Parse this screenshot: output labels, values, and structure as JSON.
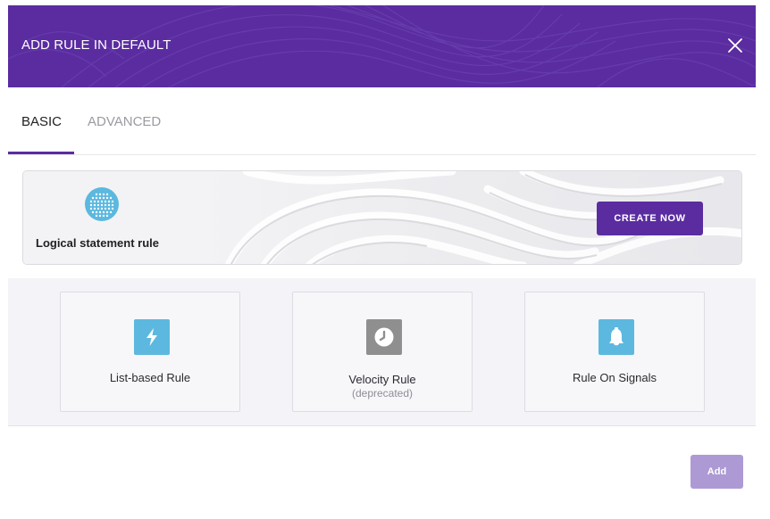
{
  "header": {
    "title": "ADD RULE IN DEFAULT",
    "close_icon": "close-icon",
    "accent_color": "#5a2ca0"
  },
  "tabs": [
    {
      "label": "BASIC",
      "active": true
    },
    {
      "label": "ADVANCED",
      "active": false
    }
  ],
  "banner": {
    "icon": "dotted-sphere-icon",
    "title": "Logical statement rule",
    "button_label": "CREATE NOW"
  },
  "rule_types": [
    {
      "label": "List-based Rule",
      "sublabel": "",
      "icon": "lightning-icon",
      "color": "#5cb8de"
    },
    {
      "label": "Velocity Rule",
      "sublabel": "(deprecated)",
      "icon": "clock-icon",
      "color": "#8f8f8f"
    },
    {
      "label": "Rule On Signals",
      "sublabel": "",
      "icon": "bell-icon",
      "color": "#5cb8de"
    }
  ],
  "footer": {
    "add_label": "Add"
  }
}
